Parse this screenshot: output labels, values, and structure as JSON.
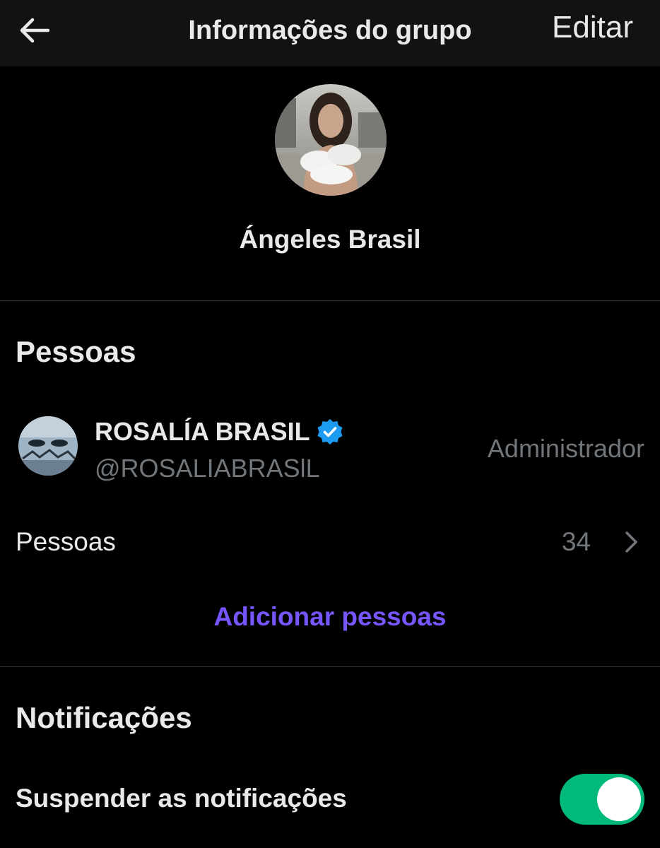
{
  "header": {
    "title": "Informações do grupo",
    "edit_label": "Editar"
  },
  "group": {
    "name": "Ángeles Brasil"
  },
  "people_section": {
    "title": "Pessoas",
    "members": [
      {
        "name": "ROSALÍA BRASIL",
        "handle": "@ROSALIABRASlL",
        "role": "Administrador",
        "verified": true
      }
    ],
    "people_row": {
      "label": "Pessoas",
      "count": "34"
    },
    "add_people_label": "Adicionar pessoas"
  },
  "notifications_section": {
    "title": "Notificações",
    "mute_label": "Suspender as notificações",
    "mute_enabled": true
  },
  "colors": {
    "background": "#000000",
    "topbar": "#121212",
    "text_primary": "#e7e9ea",
    "text_secondary": "#71767b",
    "accent_purple": "#7856ff",
    "verified_blue": "#1d9bf0",
    "toggle_on": "#00ba7c",
    "divider": "#2f3336"
  },
  "icons": {
    "back": "arrow-left-icon",
    "verified": "verified-badge-icon",
    "chevron": "chevron-right-icon"
  }
}
